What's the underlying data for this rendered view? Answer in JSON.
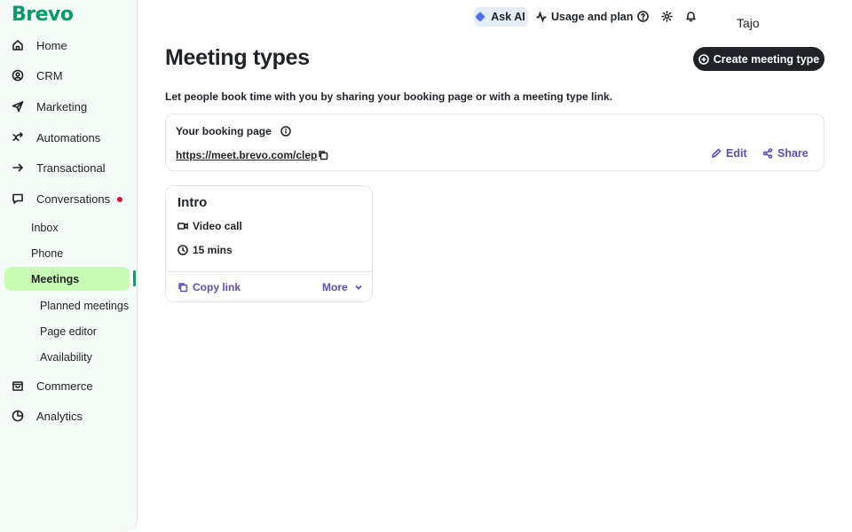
{
  "brand": {
    "logo": "Brevo",
    "accent": "#0b996e"
  },
  "sidebar": {
    "items": [
      {
        "label": "Home",
        "icon": "home-icon"
      },
      {
        "label": "CRM",
        "icon": "contacts-icon"
      },
      {
        "label": "Marketing",
        "icon": "send-icon"
      },
      {
        "label": "Automations",
        "icon": "automation-icon"
      },
      {
        "label": "Transactional",
        "icon": "arrow-right-icon"
      },
      {
        "label": "Conversations",
        "icon": "chat-icon",
        "badge_color": "#d1123a"
      },
      {
        "label": "Commerce",
        "icon": "shop-icon"
      },
      {
        "label": "Analytics",
        "icon": "pie-chart-icon"
      }
    ],
    "conversations_sub": [
      "Inbox",
      "Phone",
      "Meetings"
    ],
    "meetings_sub": [
      "Planned meetings",
      "Page editor",
      "Availability"
    ],
    "active_item": "Meetings",
    "active_color": "#c8fbb3"
  },
  "topbar": {
    "ask_ai": "Ask AI",
    "usage": "Usage and plan",
    "user": "Tajo"
  },
  "main": {
    "title": "Meeting types",
    "create_button": "Create meeting type",
    "subtitle": "Let people book time with you by sharing your booking page or with a meeting type link.",
    "booking": {
      "label": "Your booking page",
      "url": "https://meet.brevo.com/clep",
      "edit": "Edit",
      "share": "Share"
    },
    "meeting_card": {
      "name": "Intro",
      "type": "Video call",
      "duration": "15 mins",
      "copy_link": "Copy link",
      "more": "More"
    },
    "link_color": "#5b4dc0"
  }
}
